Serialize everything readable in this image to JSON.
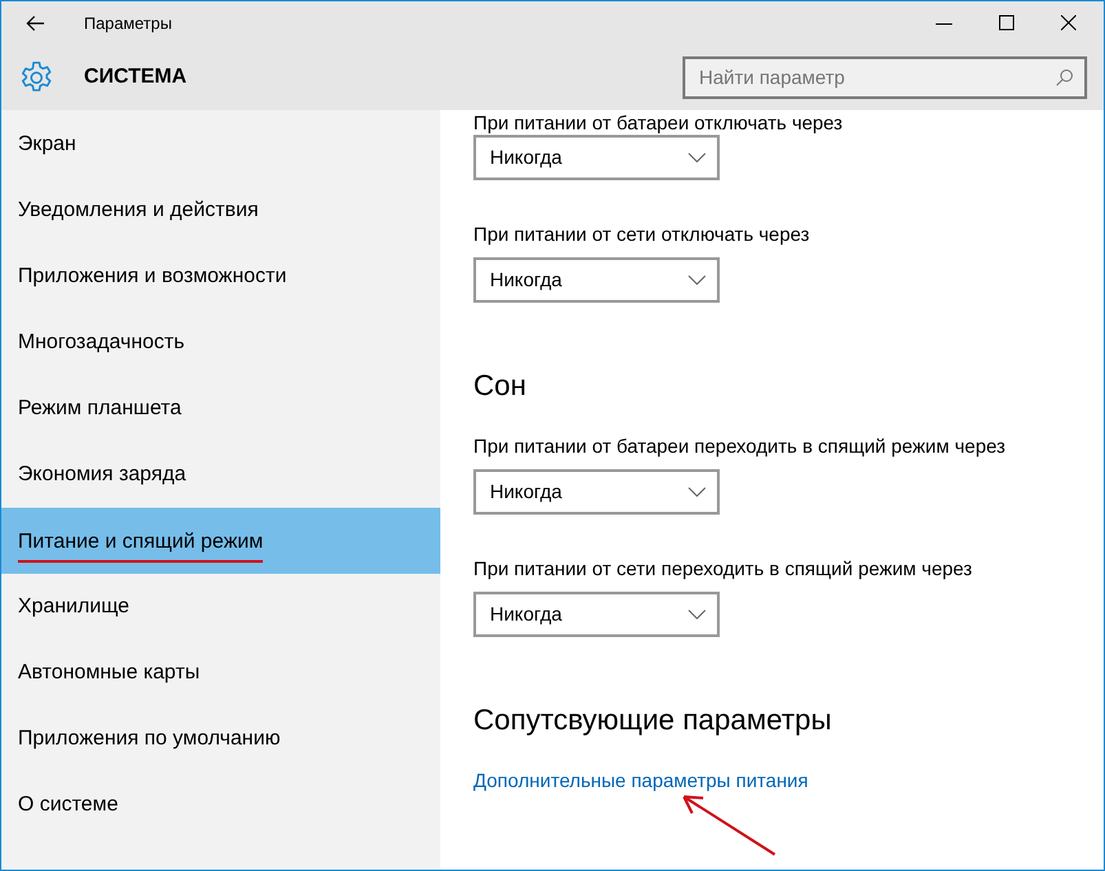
{
  "window": {
    "title": "Параметры"
  },
  "header": {
    "title": "СИСТЕМА",
    "search": {
      "placeholder": "Найти параметр"
    }
  },
  "sidebar": {
    "items": [
      {
        "label": "Экран",
        "selected": false
      },
      {
        "label": "Уведомления и действия",
        "selected": false
      },
      {
        "label": "Приложения и возможности",
        "selected": false
      },
      {
        "label": "Многозадачность",
        "selected": false
      },
      {
        "label": "Режим планшета",
        "selected": false
      },
      {
        "label": "Экономия заряда",
        "selected": false
      },
      {
        "label": "Питание и спящий режим",
        "selected": true
      },
      {
        "label": "Хранилище",
        "selected": false
      },
      {
        "label": "Автономные карты",
        "selected": false
      },
      {
        "label": "Приложения по умолчанию",
        "selected": false
      },
      {
        "label": "О системе",
        "selected": false
      }
    ]
  },
  "content": [
    {
      "kind": "setting",
      "label": "При питании от батареи отключать через",
      "value": "Никогда"
    },
    {
      "kind": "setting",
      "label": "При питании от сети отключать через",
      "value": "Никогда"
    },
    {
      "kind": "heading",
      "text": "Сон"
    },
    {
      "kind": "setting",
      "label": "При питании от батареи переходить в спящий режим через",
      "value": "Никогда"
    },
    {
      "kind": "setting",
      "label": "При питании от сети переходить в спящий режим через",
      "value": "Никогда"
    },
    {
      "kind": "heading",
      "text": "Сопутсвующие параметры"
    },
    {
      "kind": "link",
      "text": "Дополнительные параметры питания"
    }
  ]
}
